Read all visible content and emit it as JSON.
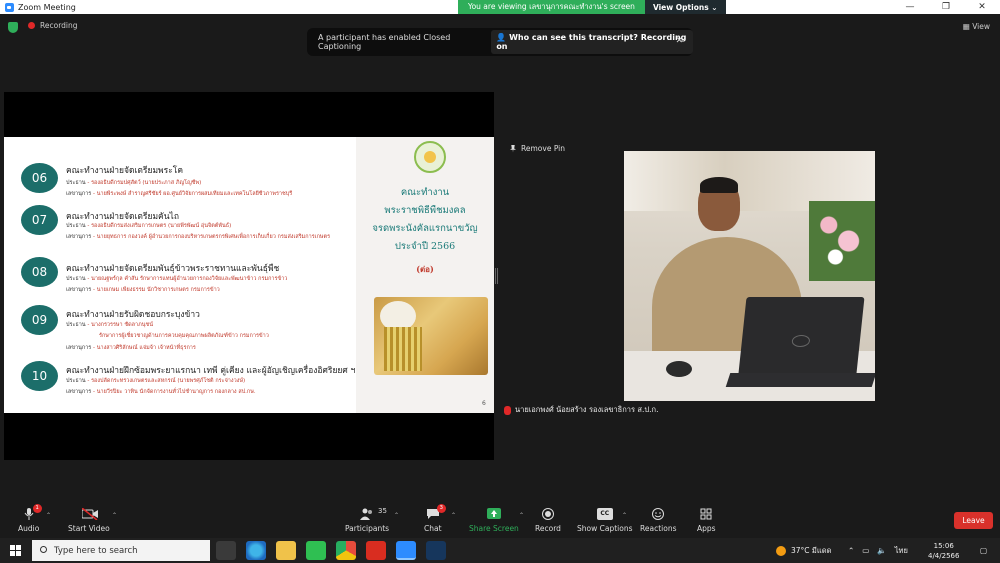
{
  "window": {
    "title": "Zoom Meeting",
    "minimize": "—",
    "maximize": "❐",
    "close": "✕"
  },
  "viewing_banner": {
    "message": "You are viewing เลขานุการคณะทำงาน's screen",
    "options": "View Options ⌄"
  },
  "recording_label": "Recording",
  "view_label": "View",
  "cc_banner": {
    "message": "A participant has enabled Closed Captioning",
    "who": "Who can see this transcript? Recording on",
    "close": "✕"
  },
  "slide": {
    "page": "6",
    "right_title": [
      "คณะทำงาน",
      "พระราชพิธีพืชมงคล",
      "จรดพระนังคัลแรกนาขวัญ",
      "ประจำปี 2566"
    ],
    "continued": "(ต่อ)",
    "items": [
      {
        "num": "06",
        "title": "คณะทำงานฝ่ายจัดเตรียมพระโค",
        "lines": [
          {
            "label": "ประธาน",
            "text": "- รองอธิบดีกรมปศุสัตว์ (นายประภาส ภิญโญชีพ)"
          },
          {
            "label": "เลขานุการ",
            "text": "- นายพีระพงษ์ สำราญศรีชัยร์ ผอ.ศูนย์วิจัยการผสมเทียมและเทคโนโลยีชีวภาพราชบุรี"
          }
        ]
      },
      {
        "num": "07",
        "title": "คณะทำงานฝ่ายจัดเตรียมคันไถ",
        "lines": [
          {
            "label": "ประธาน",
            "text": "- รองอธิบดีกรมส่งเสริมการเกษตร (นายพีรพัฒน์ อุ่นจิตต์พันธ์)"
          },
          {
            "label": "เลขานุการ",
            "text": "- นายยุทธการ กองวงค์ ผู้อำนวยการกองบริหารเกษตรกรพิเศษเพื่อการเก็บเกี่ยว กรมส่งเสริมการเกษตร"
          }
        ]
      },
      {
        "num": "08",
        "title": "คณะทำงานฝ่ายจัดเตรียมพันธุ์ข้าวพระราชทานและพันธุ์พืช",
        "lines": [
          {
            "label": "ประธาน",
            "text": "- นายณฐพร์กุล คำสัน รักษาการแทนผู้อำนวยการกองวิจัยและพัฒนาข้าว กรมการข้าว"
          },
          {
            "label": "เลขานุการ",
            "text": "- นายเกษม เพียงธรรม นักวิชาการเกษตร กรมการข้าว"
          }
        ]
      },
      {
        "num": "09",
        "title": "คณะทำงานฝ่ายรับผิดชอบกระบุงข้าว",
        "lines": [
          {
            "label": "ประธาน",
            "text": "- นางกรวรรษา ชัดลาภนุชน์"
          },
          {
            "label": "",
            "text": "รักษาการผู้เชี่ยวชาญด้านการควบคุมคุณภาพผลิตภัณฑ์ข้าว กรมการข้าว"
          },
          {
            "label": "เลขานุการ",
            "text": "- นางสาวศิริลักษณ์ แจ่มจ้า เจ้าหน้าที่ธุรการ"
          }
        ]
      },
      {
        "num": "10",
        "title": "คณะทำงานฝ่ายฝึกซ้อมพระยาแรกนา เทพี คู่เคียง และผู้อัญเชิญเครื่องอิศริยยศ ฯ",
        "lines": [
          {
            "label": "ประธาน",
            "text": "- รองปลัดกระทรวงเกษตรและสหกรณ์ (นายพรศุภ์โชติ กระจ่างวงษ์)"
          },
          {
            "label": "เลขานุการ",
            "text": "- นายวีรปิยะ วาทิน นักจัดการงานทั่วไปชำนาญการ กองกลาง สป.กษ."
          }
        ]
      }
    ]
  },
  "remove_pin": "Remove Pin",
  "participant_name": "นายเอกพงศ์ น้อยสร้าง รองเลขาธิการ ส.ป.ก.",
  "toolbar": {
    "audio": "Audio",
    "audio_badge": "1",
    "video": "Start Video",
    "participants": "Participants",
    "participants_count": "35",
    "chat": "Chat",
    "chat_badge": "3",
    "share": "Share Screen",
    "record": "Record",
    "captions": "Show Captions",
    "cc": "CC",
    "reactions": "Reactions",
    "apps": "Apps",
    "leave": "Leave"
  },
  "taskbar": {
    "search_placeholder": "Type here to search",
    "weather": "37°C มีแดด",
    "lang": "ไทย",
    "time": "15:06",
    "date": "4/4/2566"
  },
  "colors": {
    "zoom_blue": "#2d8cff",
    "share_green": "#2fae5a",
    "leave_red": "#d9312b",
    "slide_teal": "#1c6e6a"
  }
}
